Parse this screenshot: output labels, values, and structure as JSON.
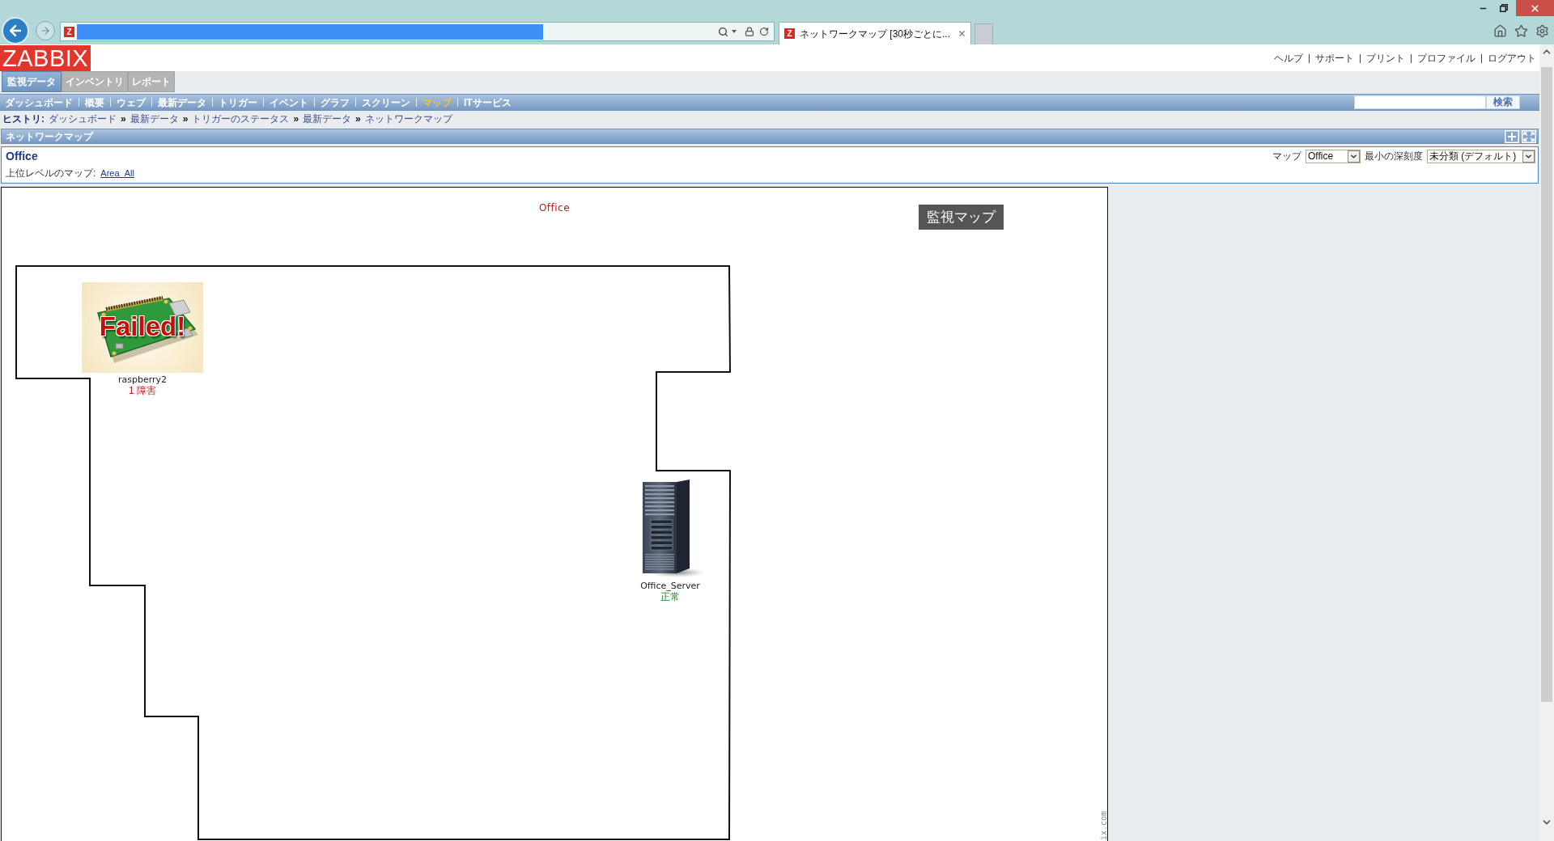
{
  "browser": {
    "address_favicon": "Z",
    "tab": {
      "favicon": "Z",
      "title": "ネットワークマップ [30秒ごとに..."
    }
  },
  "header": {
    "logo": "ZABBIX",
    "links": [
      "ヘルプ",
      "サポート",
      "プリント",
      "プロファイル",
      "ログアウト"
    ]
  },
  "main_tabs": [
    {
      "label": "監視データ",
      "selected": true
    },
    {
      "label": "インベントリ",
      "selected": false
    },
    {
      "label": "レポート",
      "selected": false
    }
  ],
  "sub_menu": [
    {
      "label": "ダッシュボード",
      "selected": false
    },
    {
      "label": "概要",
      "selected": false
    },
    {
      "label": "ウェブ",
      "selected": false
    },
    {
      "label": "最新データ",
      "selected": false
    },
    {
      "label": "トリガー",
      "selected": false
    },
    {
      "label": "イベント",
      "selected": false
    },
    {
      "label": "グラフ",
      "selected": false
    },
    {
      "label": "スクリーン",
      "selected": false
    },
    {
      "label": "マップ",
      "selected": true
    },
    {
      "label": "ITサービス",
      "selected": false
    }
  ],
  "search": {
    "button": "検索"
  },
  "history": {
    "label": "ヒストリ:",
    "separator": "»",
    "items": [
      "ダッシュボード",
      "最新データ",
      "トリガーのステータス",
      "最新データ",
      "ネットワークマップ"
    ]
  },
  "panel": {
    "title": "ネットワークマップ"
  },
  "map_info": {
    "name": "Office",
    "parent_label": "上位レベルのマップ:",
    "parent_link": "Area_All",
    "map_select": {
      "label": "マップ",
      "value": "Office"
    },
    "severity_select": {
      "label": "最小の深刻度",
      "value": "未分類 (デフォルト)"
    }
  },
  "map": {
    "title": "Office",
    "label": "監視マップ",
    "elements": [
      {
        "kind": "board",
        "name": "raspberry2",
        "image_text": "Failed!",
        "status": "1 障害",
        "problem": true
      },
      {
        "kind": "server",
        "name": "Office_Server",
        "status": "正常",
        "problem": false
      }
    ],
    "footer_text": "ix.com"
  }
}
